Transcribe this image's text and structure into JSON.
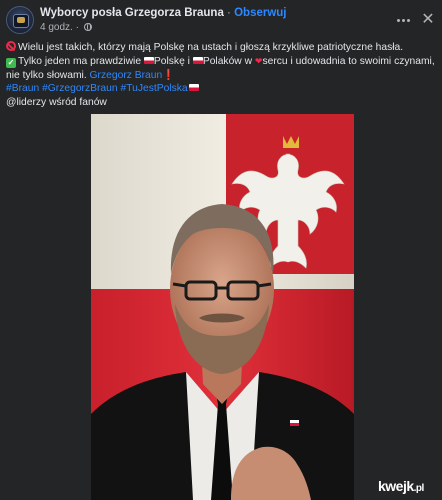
{
  "header": {
    "page_name": "Wyborcy posła Grzegorza Brauna",
    "separator": "·",
    "follow_label": "Obserwuj",
    "time": "4 godz.",
    "meta_sep": "·",
    "avatar_icon": "group-avatar-icon",
    "more_icon": "more-dots-icon",
    "close_icon": "close-icon"
  },
  "post": {
    "line1": "Wielu jest takich, którzy mają Polskę na ustach i głoszą krzykliwe patriotyczne hasła.",
    "line2_a": "Tylko jeden ma prawdziwie ",
    "line2_b": "Polskę i ",
    "line2_c": "Polaków w ",
    "line2_d": "sercu i udowadnia to swoimi czynami,",
    "line3_a": "nie tylko słowami. ",
    "line3_link": "Grzegorz Braun",
    "line3_excl": "❗",
    "hashtags": "#Braun #GrzegorzBraun #TuJestPolska",
    "mention": "@liderzy wśród fanów"
  },
  "watermark": {
    "brand": "kwejk",
    "tld": ".pl"
  },
  "colors": {
    "background": "#242526",
    "text": "#e4e6eb",
    "secondary": "#b0b3b8",
    "link": "#2d88ff",
    "flag_red": "#dc143c"
  }
}
